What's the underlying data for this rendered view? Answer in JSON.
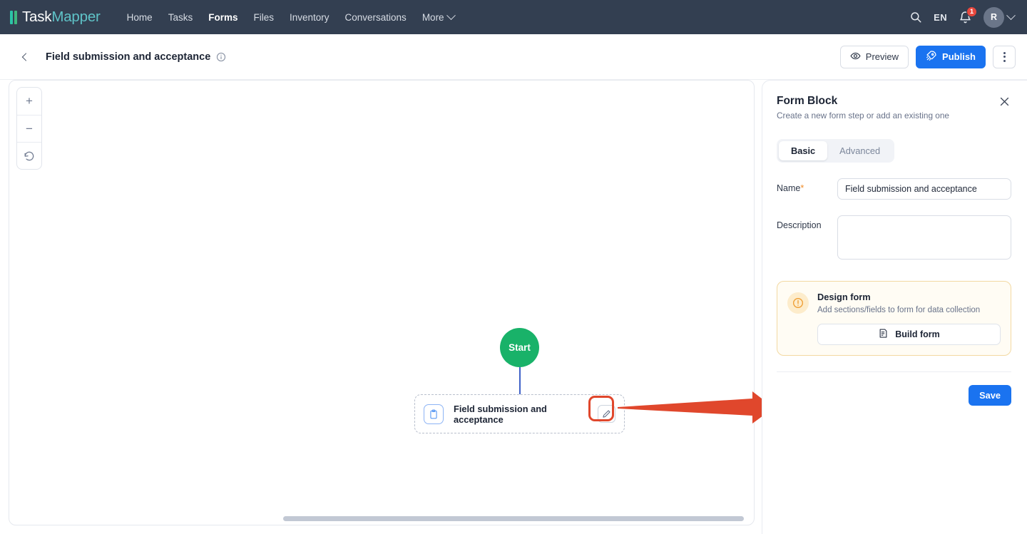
{
  "topnav": {
    "logo": {
      "part1": "Task",
      "part2": "Mapper",
      "icon": "bars-logo-icon"
    },
    "links": [
      {
        "label": "Home",
        "active": false
      },
      {
        "label": "Tasks",
        "active": false
      },
      {
        "label": "Forms",
        "active": true
      },
      {
        "label": "Files",
        "active": false
      },
      {
        "label": "Inventory",
        "active": false
      },
      {
        "label": "Conversations",
        "active": false
      },
      {
        "label": "More",
        "active": false,
        "has_chevron": true
      }
    ],
    "search_icon": "search-icon",
    "language": "EN",
    "notifications_icon": "bell-icon",
    "notifications_count": "1",
    "avatar_initial": "R",
    "avatar_chevron": "chevron-down-icon"
  },
  "subheader": {
    "back_icon": "chevron-left-icon",
    "title": "Field submission and acceptance",
    "info_icon": "info-circle-icon",
    "preview_label": "Preview",
    "preview_icon": "eye-icon",
    "publish_label": "Publish",
    "publish_icon": "rocket-icon",
    "more_icon": "kebab-menu-icon"
  },
  "canvas": {
    "zoom_in": "+",
    "zoom_out": "−",
    "reset_icon": "reset-rotate-icon",
    "start_node_label": "Start",
    "form_node_label": "Field submission and acceptance",
    "form_node_icon": "clipboard-icon",
    "form_node_edit_icon": "pencil-icon",
    "annotation": {
      "type": "red-arrow",
      "color": "#e0472c"
    }
  },
  "panel": {
    "title": "Form Block",
    "subtitle": "Create a new form step or add an existing one",
    "close_icon": "close-icon",
    "tabs": [
      {
        "label": "Basic",
        "active": true
      },
      {
        "label": "Advanced",
        "active": false
      }
    ],
    "fields": {
      "name_label": "Name",
      "name_required_mark": "*",
      "name_value": "Field submission and acceptance",
      "name_placeholder": "",
      "description_label": "Description",
      "description_value": "",
      "description_placeholder": ""
    },
    "callout": {
      "icon": "alert-circle-icon",
      "title": "Design form",
      "subtitle": "Add sections/fields to form for data collection",
      "button_label": "Build form",
      "button_icon": "form-document-icon",
      "accent_color": "#f0a33c"
    },
    "save_label": "Save"
  },
  "colors": {
    "nav_bg": "#333f51",
    "primary": "#1a73f0",
    "start_node": "#19b269",
    "annotation_red": "#e0472c",
    "callout_bg": "#fffcf4"
  }
}
